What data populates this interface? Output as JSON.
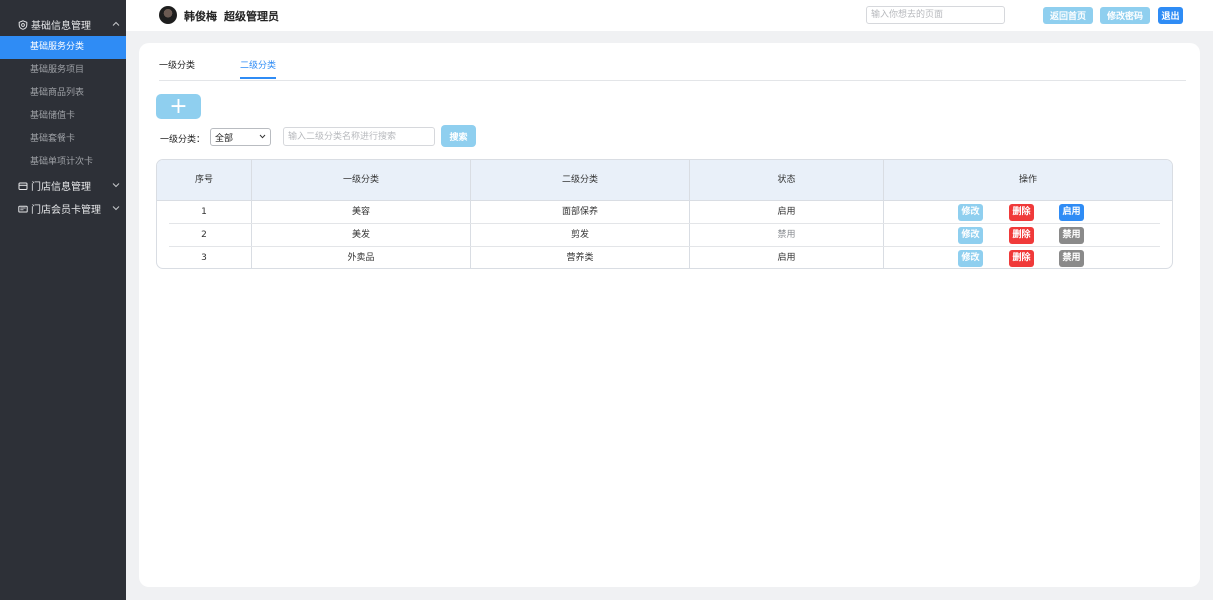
{
  "sidebar": {
    "groups": [
      {
        "label": "基础信息管理",
        "chevron": "^",
        "icon": "shield-gear-icon"
      },
      {
        "label": "门店信息管理",
        "chevron": "⌄",
        "icon": "store-icon"
      },
      {
        "label": "门店会员卡管理",
        "chevron": "⌄",
        "icon": "card-icon"
      }
    ],
    "items": [
      {
        "label": "基础服务分类"
      },
      {
        "label": "基础服务项目"
      },
      {
        "label": "基础商品列表"
      },
      {
        "label": "基础储值卡"
      },
      {
        "label": "基础套餐卡"
      },
      {
        "label": "基础单项计次卡"
      }
    ]
  },
  "header": {
    "user_name": "韩俊梅",
    "user_role": "超级管理员",
    "search_placeholder": "输入你想去的页面",
    "home_label": "返回首页",
    "password_label": "修改密码",
    "logout_label": "退出"
  },
  "tabs": [
    {
      "label": "一级分类"
    },
    {
      "label": "二级分类"
    }
  ],
  "toolbar": {
    "add_label": "+",
    "filter_label": "一级分类：",
    "filter_selected": "全部",
    "search_placeholder": "输入二级分类名称进行搜索",
    "search_label": "搜索"
  },
  "table": {
    "headers": [
      "序号",
      "一级分类",
      "二级分类",
      "状态",
      "操作"
    ],
    "rows": [
      {
        "index": "1",
        "level1": "美容",
        "level2": "面部保养",
        "status": "启用",
        "edit": "修改",
        "delete": "删除",
        "toggle": "启用"
      },
      {
        "index": "2",
        "level1": "美发",
        "level2": "剪发",
        "status": "禁用",
        "edit": "修改",
        "delete": "删除",
        "toggle": "禁用"
      },
      {
        "index": "3",
        "level1": "外卖品",
        "level2": "营养类",
        "status": "启用",
        "edit": "修改",
        "delete": "删除",
        "toggle": "禁用"
      }
    ]
  },
  "colors": {
    "sidebar_bg": "#2d3037",
    "accent": "#2f8cf5",
    "light_accent": "#8fcfef",
    "danger": "#f03a3a",
    "neutral_button": "#8a8a8a"
  }
}
